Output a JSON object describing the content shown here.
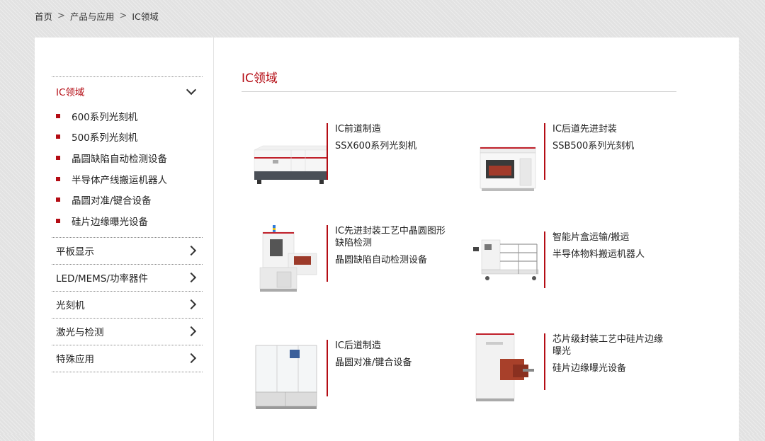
{
  "breadcrumb": {
    "home": "首页",
    "products": "产品与应用",
    "current": "IC领域"
  },
  "sidebar": {
    "active": {
      "label": "IC领域",
      "items": [
        "600系列光刻机",
        "500系列光刻机",
        "晶圆缺陷自动检测设备",
        "半导体产线搬运机器人",
        "晶圆对准/键合设备",
        "硅片边缘曝光设备"
      ]
    },
    "categories": [
      "平板显示",
      "LED/MEMS/功率器件",
      "光刻机",
      "激光与检测",
      "特殊应用"
    ]
  },
  "main": {
    "title": "IC领域",
    "products": [
      {
        "category": "IC前道制造",
        "name": "SSX600系列光刻机",
        "icon": "lithography-machine"
      },
      {
        "category": "IC后道先进封装",
        "name": "SSB500系列光刻机",
        "icon": "packaging-lithography-machine"
      },
      {
        "category": "IC先进封装工艺中晶圆图形缺陷检测",
        "name": "晶圆缺陷自动检测设备",
        "icon": "wafer-inspection-machine"
      },
      {
        "category": "智能片盒运输/搬运",
        "name": "半导体物料搬运机器人",
        "icon": "transport-robot"
      },
      {
        "category": "IC后道制造",
        "name": "晶圆对准/键合设备",
        "icon": "bonding-machine"
      },
      {
        "category": "芯片级封装工艺中硅片边缘曝光",
        "name": "硅片边缘曝光设备",
        "icon": "edge-exposure-machine"
      }
    ]
  },
  "colors": {
    "accent": "#b40c14"
  }
}
